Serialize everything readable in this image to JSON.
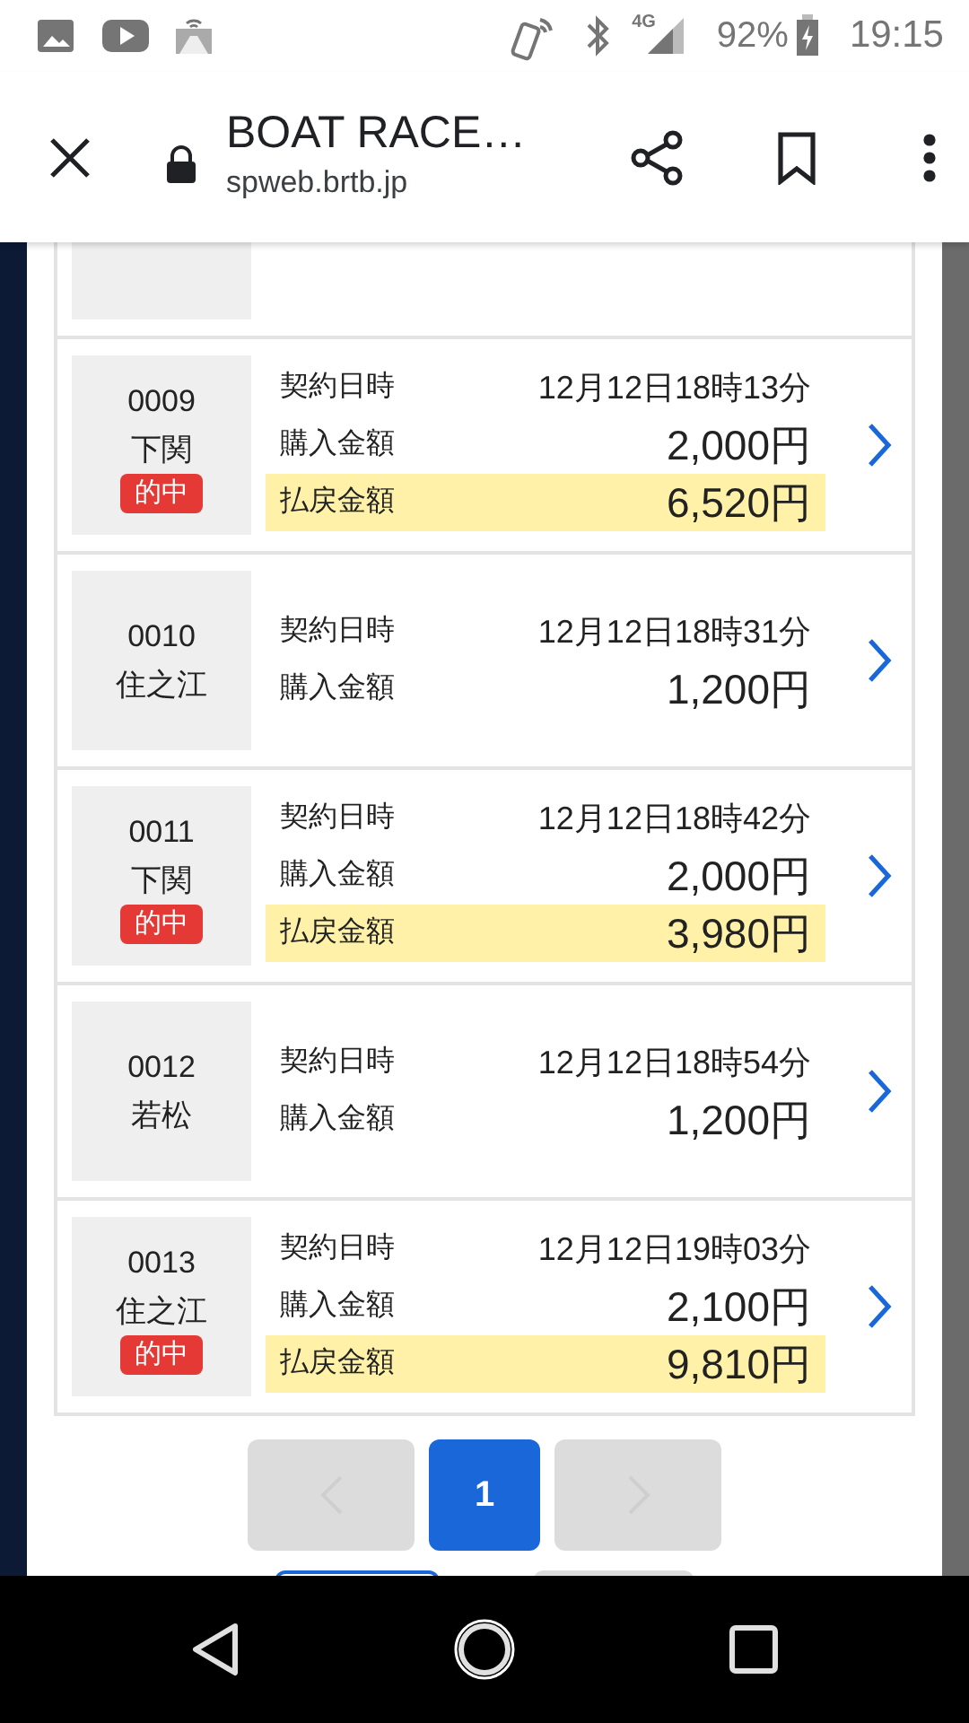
{
  "status_bar": {
    "network": "4G",
    "battery": "92%",
    "time": "19:15"
  },
  "browser": {
    "title": "BOAT RACE…",
    "url": "spweb.brtb.jp"
  },
  "rows": [
    {
      "number": "0009",
      "venue": "下関",
      "hit": true,
      "hit_label": "的中",
      "lines": [
        {
          "kind": "date",
          "label": "契約日時",
          "value": "12月12日18時13分"
        },
        {
          "kind": "amount",
          "label": "購入金額",
          "value": "2,000円"
        },
        {
          "kind": "payout",
          "label": "払戻金額",
          "value": "6,520円"
        }
      ]
    },
    {
      "number": "0010",
      "venue": "住之江",
      "hit": false,
      "lines": [
        {
          "kind": "date",
          "label": "契約日時",
          "value": "12月12日18時31分"
        },
        {
          "kind": "amount",
          "label": "購入金額",
          "value": "1,200円"
        }
      ]
    },
    {
      "number": "0011",
      "venue": "下関",
      "hit": true,
      "hit_label": "的中",
      "lines": [
        {
          "kind": "date",
          "label": "契約日時",
          "value": "12月12日18時42分"
        },
        {
          "kind": "amount",
          "label": "購入金額",
          "value": "2,000円"
        },
        {
          "kind": "payout",
          "label": "払戻金額",
          "value": "3,980円"
        }
      ]
    },
    {
      "number": "0012",
      "venue": "若松",
      "hit": false,
      "lines": [
        {
          "kind": "date",
          "label": "契約日時",
          "value": "12月12日18時54分"
        },
        {
          "kind": "amount",
          "label": "購入金額",
          "value": "1,200円"
        }
      ]
    },
    {
      "number": "0013",
      "venue": "住之江",
      "hit": true,
      "hit_label": "的中",
      "lines": [
        {
          "kind": "date",
          "label": "契約日時",
          "value": "12月12日19時03分"
        },
        {
          "kind": "amount",
          "label": "購入金額",
          "value": "2,100円"
        },
        {
          "kind": "payout",
          "label": "払戻金額",
          "value": "9,810円"
        }
      ]
    }
  ],
  "pagination": {
    "prev_disabled": true,
    "pages": [
      {
        "label": "1",
        "selected": true
      }
    ],
    "next_disabled": true
  }
}
